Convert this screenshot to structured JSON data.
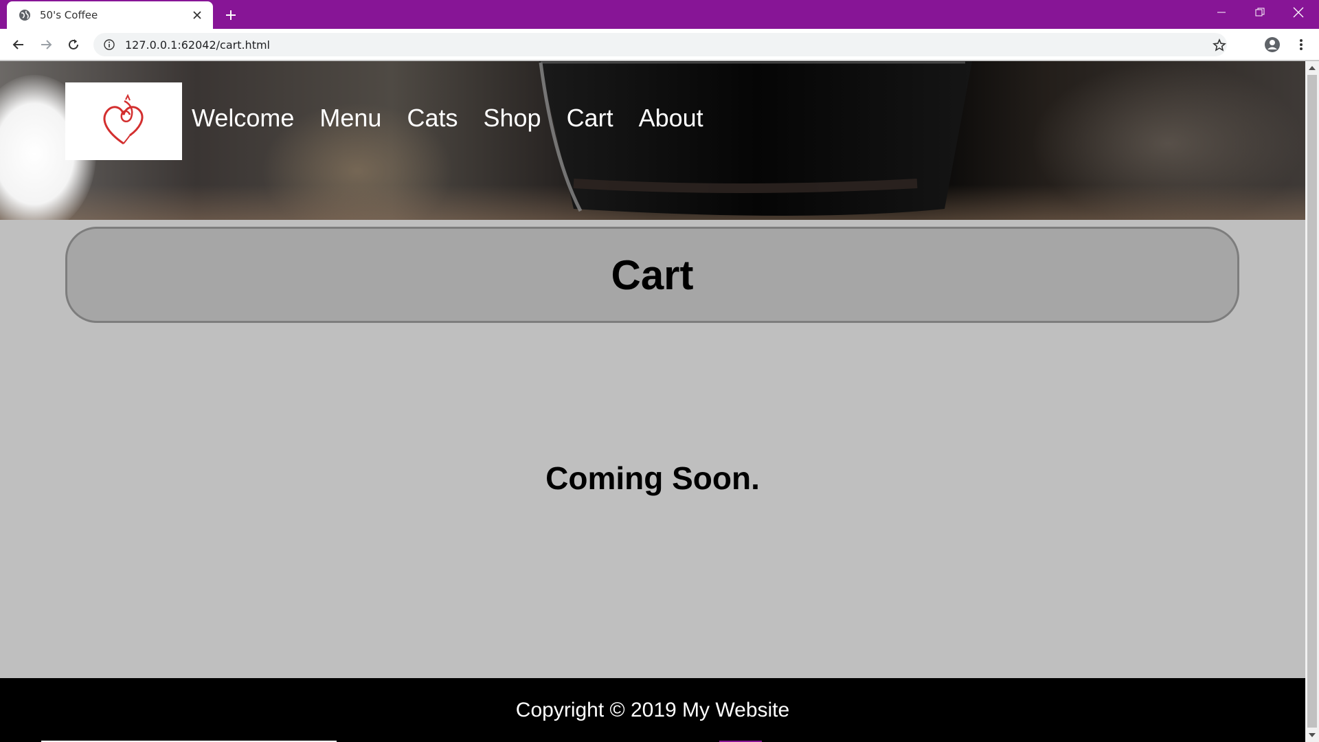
{
  "browser": {
    "tab_title": "50's Coffee",
    "url": "127.0.0.1:62042/cart.html",
    "accent_color": "#871596"
  },
  "site": {
    "nav": [
      "Welcome",
      "Menu",
      "Cats",
      "Shop",
      "Cart",
      "About"
    ],
    "page_heading": "Cart",
    "message": "Coming Soon.",
    "footer_text": "Copyright © 2019 My Website"
  },
  "colors": {
    "page_background": "#bfbfbf",
    "banner_background": "#a6a6a6",
    "footer_background": "#000000",
    "logo_color": "#d32f2f"
  },
  "icons": {
    "tab_favicon": "globe-icon",
    "tab_close": "close-icon",
    "new_tab": "plus-icon",
    "back": "back-arrow-icon",
    "forward": "forward-arrow-icon",
    "reload": "reload-icon",
    "site_info": "info-icon",
    "bookmark": "star-icon",
    "profile": "account-icon",
    "menu": "kebab-menu-icon",
    "logo": "cat-heart-logo"
  }
}
